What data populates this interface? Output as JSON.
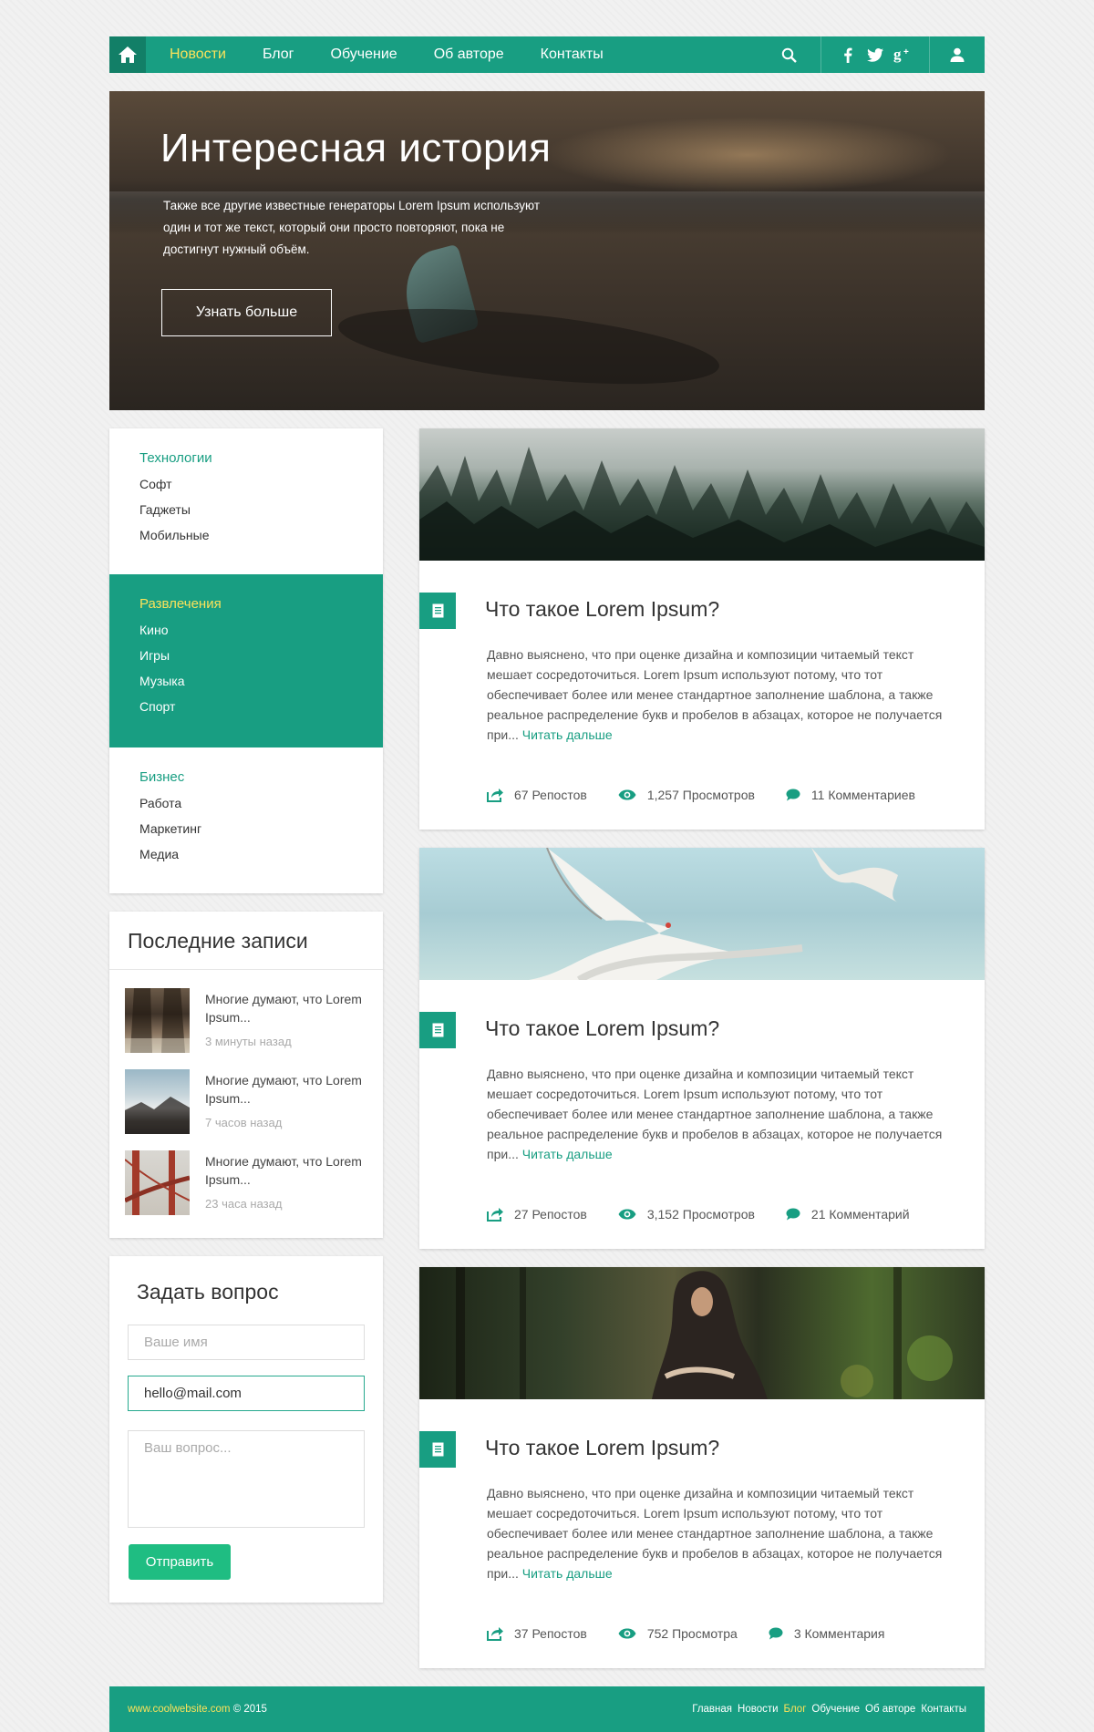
{
  "nav": {
    "items": [
      "Новости",
      "Блог",
      "Обучение",
      "Об авторе",
      "Контакты"
    ],
    "active_index": 0,
    "icons": [
      "home-icon",
      "search-icon",
      "facebook-icon",
      "twitter-icon",
      "google-plus-icon",
      "user-icon"
    ]
  },
  "hero": {
    "title": "Интересная история",
    "text": "Также все другие известные генераторы Lorem Ipsum используют один и тот же текст, который они просто повторяют, пока не достигнут нужный объём.",
    "button": "Узнать больше"
  },
  "categories": [
    {
      "title": "Технологии",
      "items": [
        "Софт",
        "Гаджеты",
        "Мобильные"
      ],
      "active": false
    },
    {
      "title": "Развлечения",
      "items": [
        "Кино",
        "Игры",
        "Музыка",
        "Спорт"
      ],
      "active": true
    },
    {
      "title": "Бизнес",
      "items": [
        "Работа",
        "Маркетинг",
        "Медиа"
      ],
      "active": false
    }
  ],
  "recent": {
    "title": "Последние записи",
    "items": [
      {
        "text": "Многие думают, что Lorem Ipsum...",
        "date": "3 минуты назад"
      },
      {
        "text": "Многие думают, что Lorem Ipsum...",
        "date": "7 часов назад"
      },
      {
        "text": "Многие думают, что Lorem Ipsum...",
        "date": "23 часа назад"
      }
    ]
  },
  "ask": {
    "title": "Задать вопрос",
    "name_placeholder": "Ваше имя",
    "email_value": "hello@mail.com",
    "question_placeholder": "Ваш вопрос...",
    "submit": "Отправить"
  },
  "posts": [
    {
      "title": "Что такое Lorem Ipsum?",
      "text": "Давно выяснено, что при оценке дизайна и композиции читаемый текст мешает сосредоточиться. Lorem Ipsum используют потому, что тот обеспечивает более или менее стандартное заполнение шаблона, а также реальное распределение букв и пробелов в абзацах, которое не получается при...",
      "more": "Читать дальше",
      "reposts": "67 Репостов",
      "views": "1,257 Просмотров",
      "comments": "11 Комментариев"
    },
    {
      "title": "Что такое Lorem Ipsum?",
      "text": "Давно выяснено, что при оценке дизайна и композиции читаемый текст мешает сосредоточиться. Lorem Ipsum используют потому, что тот обеспечивает более или менее стандартное заполнение шаблона, а также реальное распределение букв и пробелов в абзацах, которое не получается при...",
      "more": "Читать дальше",
      "reposts": "27 Репостов",
      "views": "3,152 Просмотров",
      "comments": "21 Комментарий"
    },
    {
      "title": "Что такое Lorem Ipsum?",
      "text": "Давно выяснено, что при оценке дизайна и композиции читаемый текст мешает сосредоточиться. Lorem Ipsum используют потому, что тот обеспечивает более или менее стандартное заполнение шаблона, а также реальное распределение букв и пробелов в абзацах, которое не получается при...",
      "more": "Читать дальше",
      "reposts": "37 Репостов",
      "views": "752 Просмотра",
      "comments": "3 Комментария"
    }
  ],
  "footer": {
    "site": "www.coolwebsite.com",
    "copyright": "© 2015",
    "links": [
      "Главная",
      "Новости",
      "Блог",
      "Обучение",
      "Об авторе",
      "Контакты"
    ],
    "active_index": 2
  },
  "colors": {
    "accent": "#189e82",
    "highlight": "#fbe25a",
    "button": "#1fbd82"
  }
}
